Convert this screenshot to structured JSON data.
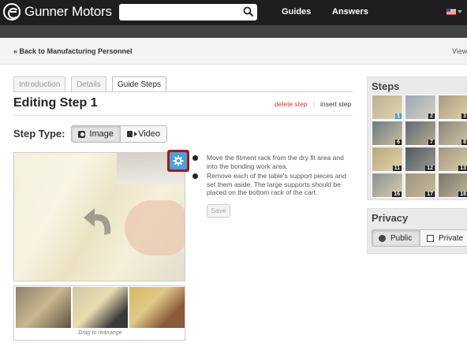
{
  "header": {
    "logo_text": "Gunner Motors",
    "search_placeholder": "",
    "nav": [
      "Guides",
      "Answers"
    ]
  },
  "breadcrumb": {
    "back": "« Back to Manufacturing Personnel",
    "view": "View"
  },
  "tabs": [
    {
      "label": "Introduction",
      "active": false
    },
    {
      "label": "Details",
      "active": false
    },
    {
      "label": "Guide Steps",
      "active": true
    }
  ],
  "editor": {
    "title": "Editing Step 1",
    "delete_label": "delete step",
    "separator": "|",
    "insert_label": "insert step",
    "step_type_label": "Step Type:",
    "image_option": "Image",
    "video_option": "Video",
    "drag_hint": "Drag to rearrange",
    "bullets": [
      "Move the fitment rack from the dry fit area and into the bonding work area.",
      "Remove each of the table's support pieces and set them aside. The large supports should be placed on the bottom rack of the cart."
    ],
    "save_label": "Save"
  },
  "steps_panel": {
    "title": "Steps",
    "thumbnails": [
      "1",
      "2",
      "3",
      "6",
      "7",
      "8",
      "11",
      "12",
      "13",
      "16",
      "17",
      "18"
    ]
  },
  "privacy_panel": {
    "title": "Privacy",
    "public_label": "Public",
    "private_label": "Private"
  },
  "colors": {
    "accent_red": "#cc3a2a",
    "gear_blue": "#4aa0d8",
    "highlight_border": "#9e1b1b"
  }
}
